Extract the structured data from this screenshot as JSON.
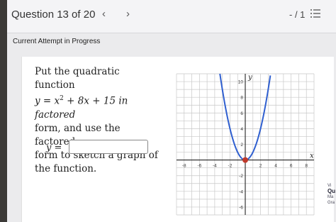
{
  "header": {
    "question_label": "Question 13 of 20",
    "prev_glyph": "‹",
    "next_glyph": "›",
    "score": "- / 1"
  },
  "status": "Current Attempt in Progress",
  "question": {
    "line1": "Put the quadratic function",
    "line2_pre": "y = x",
    "line2_exp": "2",
    "line2_post": " + 8x + 15 in factored",
    "line3": "form, and use the factored",
    "line4": "form to sketch a graph of",
    "line5": "the function.",
    "answer_label": "y =",
    "answer_value": ""
  },
  "graph": {
    "x_axis_label": "x",
    "y_axis_label": "y",
    "x_ticks": [
      "-8",
      "-6",
      "-4",
      "-2",
      "2",
      "4",
      "6",
      "8"
    ],
    "y_ticks": [
      "10",
      "8",
      "6",
      "4",
      "2",
      "-2",
      "-4",
      "-6"
    ],
    "xlim": [
      -9,
      9
    ],
    "ylim": [
      -7,
      11
    ],
    "curve": "y = x^2",
    "point": {
      "x": 0,
      "y": 0
    },
    "colors": {
      "curve": "#2f5fd0",
      "point": "#c0392b",
      "grid": "#c8c8c8"
    }
  },
  "side_panel": {
    "title_fragment": "Vi",
    "bold_fragment": "Qu",
    "small1": "Ma",
    "small2": "Gra"
  }
}
